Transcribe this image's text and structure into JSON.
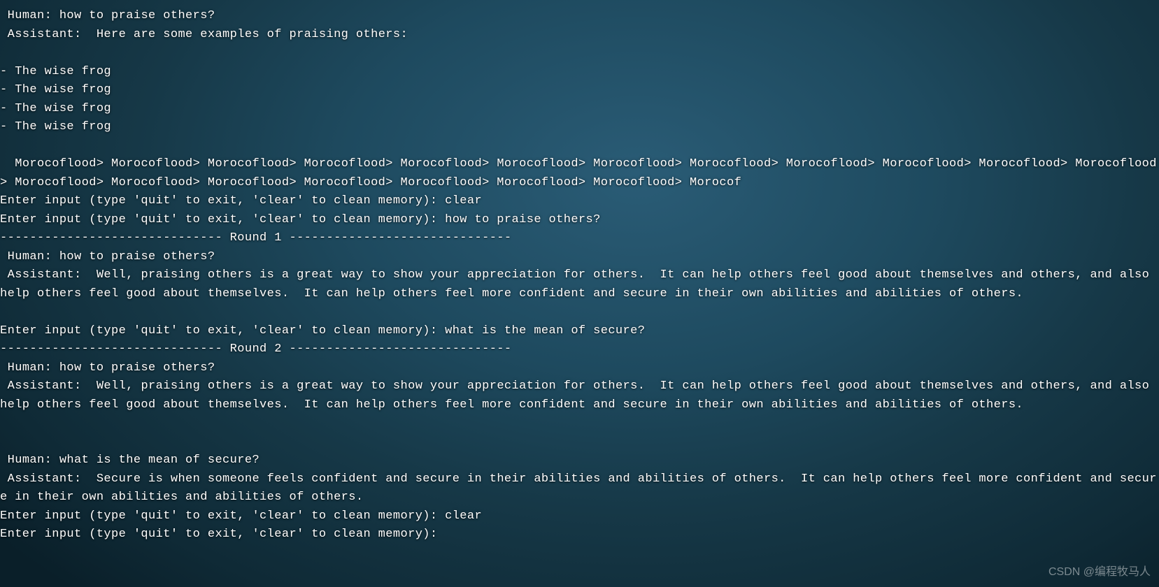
{
  "terminal": {
    "lines": [
      " Human: how to praise others?",
      " Assistant:  Here are some examples of praising others:",
      "",
      "- The wise frog",
      "- The wise frog",
      "- The wise frog",
      "- The wise frog",
      "",
      "  Morocoflood> Morocoflood> Morocoflood> Morocoflood> Morocoflood> Morocoflood> Morocoflood> Morocoflood> Morocoflood> Morocoflood> Morocoflood> Morocoflood> Morocoflood> Morocoflood> Morocoflood> Morocoflood> Morocoflood> Morocoflood> Morocoflood> Morocof",
      "Enter input (type 'quit' to exit, 'clear' to clean memory): clear",
      "Enter input (type 'quit' to exit, 'clear' to clean memory): how to praise others?",
      "------------------------------ Round 1 ------------------------------",
      " Human: how to praise others?",
      " Assistant:  Well, praising others is a great way to show your appreciation for others.  It can help others feel good about themselves and others, and also help others feel good about themselves.  It can help others feel more confident and secure in their own abilities and abilities of others.",
      "",
      "Enter input (type 'quit' to exit, 'clear' to clean memory): what is the mean of secure?",
      "------------------------------ Round 2 ------------------------------",
      " Human: how to praise others?",
      " Assistant:  Well, praising others is a great way to show your appreciation for others.  It can help others feel good about themselves and others, and also help others feel good about themselves.  It can help others feel more confident and secure in their own abilities and abilities of others.",
      "",
      "",
      " Human: what is the mean of secure?",
      " Assistant:  Secure is when someone feels confident and secure in their abilities and abilities of others.  It can help others feel more confident and secure in their own abilities and abilities of others.",
      "Enter input (type 'quit' to exit, 'clear' to clean memory): clear",
      "Enter input (type 'quit' to exit, 'clear' to clean memory): "
    ]
  },
  "watermark": "CSDN @编程牧马人"
}
